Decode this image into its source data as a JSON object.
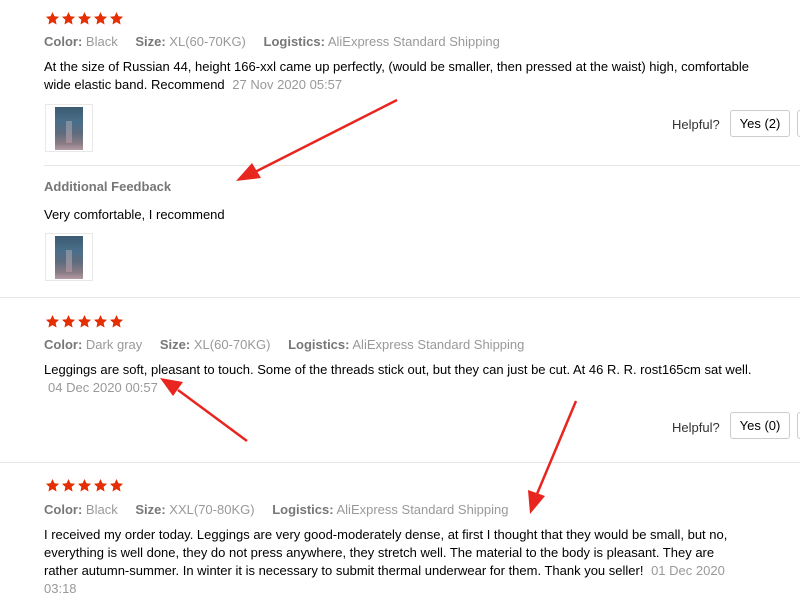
{
  "colors": {
    "star": "#e62e04",
    "arrow": "#e8251e",
    "muted": "#999999",
    "key": "#777777"
  },
  "reviews": [
    {
      "stars": 5,
      "color_label": "Color:",
      "color_value": "Black",
      "size_label": "Size:",
      "size_value": "XL(60-70KG)",
      "logistics_label": "Logistics:",
      "logistics_value": "AliExpress Standard Shipping",
      "text_line1": "At the size of Russian 44, height 166-xxl came up perfectly, (would be smaller, then pressed at the waist) high, comfortable",
      "text_line2": "wide elastic band. Recommend",
      "date": "27 Nov 2020 05:57",
      "helpful_label": "Helpful?",
      "yes_button": "Yes (2)",
      "additional_feedback_label": "Additional Feedback",
      "additional_feedback_text": "Very comfortable, I recommend"
    },
    {
      "stars": 5,
      "color_label": "Color:",
      "color_value": "Dark gray",
      "size_label": "Size:",
      "size_value": "XL(60-70KG)",
      "logistics_label": "Logistics:",
      "logistics_value": "AliExpress Standard Shipping",
      "text_line1": "Leggings are soft, pleasant to touch. Some of the threads stick out, but they can just be cut. At 46 R. R. rost165cm sat well.",
      "date": "04 Dec 2020 00:57",
      "helpful_label": "Helpful?",
      "yes_button": "Yes (0)"
    },
    {
      "stars": 5,
      "color_label": "Color:",
      "color_value": "Black",
      "size_label": "Size:",
      "size_value": "XXL(70-80KG)",
      "logistics_label": "Logistics:",
      "logistics_value": "AliExpress Standard Shipping",
      "text_line1": "I received my order today. Leggings are very good-moderately dense, at first I thought that they would be small, but no,",
      "text_line2": "everything is well done, they do not press anywhere, they stretch well. The material to the body is pleasant. They are",
      "text_line3": "rather autumn-summer. In winter it is necessary to submit thermal underwear for them. Thank you seller!",
      "date_part1": "01 Dec 2020",
      "date_part2": "03:18"
    }
  ]
}
